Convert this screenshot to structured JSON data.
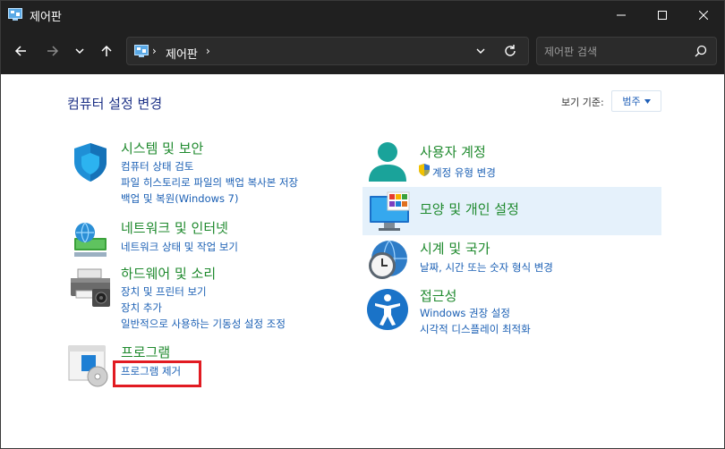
{
  "window": {
    "title": "제어판"
  },
  "navbar": {
    "breadcrumb": "제어판",
    "search_placeholder": "제어판 검색"
  },
  "content": {
    "page_title": "컴퓨터 설정 변경",
    "view_by_label": "보기 기준:",
    "view_by_value": "범주"
  },
  "categories": {
    "system": {
      "title": "시스템 및 보안",
      "links": [
        "컴퓨터 상태 검토",
        "파일 히스토리로 파일의 백업 복사본 저장",
        "백업 및 복원(Windows 7)"
      ]
    },
    "network": {
      "title": "네트워크 및 인터넷",
      "links": [
        "네트워크 상태 및 작업 보기"
      ]
    },
    "hardware": {
      "title": "하드웨어 및 소리",
      "links": [
        "장치 및 프린터 보기",
        "장치 추가",
        "일반적으로 사용하는 기동성 설정 조정"
      ]
    },
    "programs": {
      "title": "프로그램",
      "links": [
        "프로그램 제거"
      ]
    },
    "users": {
      "title": "사용자 계정",
      "links": [
        "계정 유형 변경"
      ]
    },
    "appearance": {
      "title": "모양 및 개인 설정",
      "links": []
    },
    "clock": {
      "title": "시계 및 국가",
      "links": [
        "날짜, 시간 또는 숫자 형식 변경"
      ]
    },
    "access": {
      "title": "접근성",
      "links": [
        "Windows 권장 설정",
        "시각적 디스플레이 최적화"
      ]
    }
  },
  "colors": {
    "titlebar": "#202020",
    "category_title": "#1f8a2e",
    "link": "#1a5fb4",
    "highlight": "#e5f1fb",
    "annotation_box": "#e11b22"
  },
  "icons": [
    "control-panel-icon",
    "back-arrow-icon",
    "forward-arrow-icon",
    "recent-dropdown-icon",
    "up-arrow-icon",
    "refresh-icon",
    "search-icon",
    "minimize-icon",
    "maximize-icon",
    "close-icon",
    "shield-icon",
    "globe-network-icon",
    "printer-icon",
    "programs-disc-icon",
    "user-icon",
    "uac-shield-icon",
    "monitor-icon",
    "clock-globe-icon",
    "accessibility-icon"
  ]
}
